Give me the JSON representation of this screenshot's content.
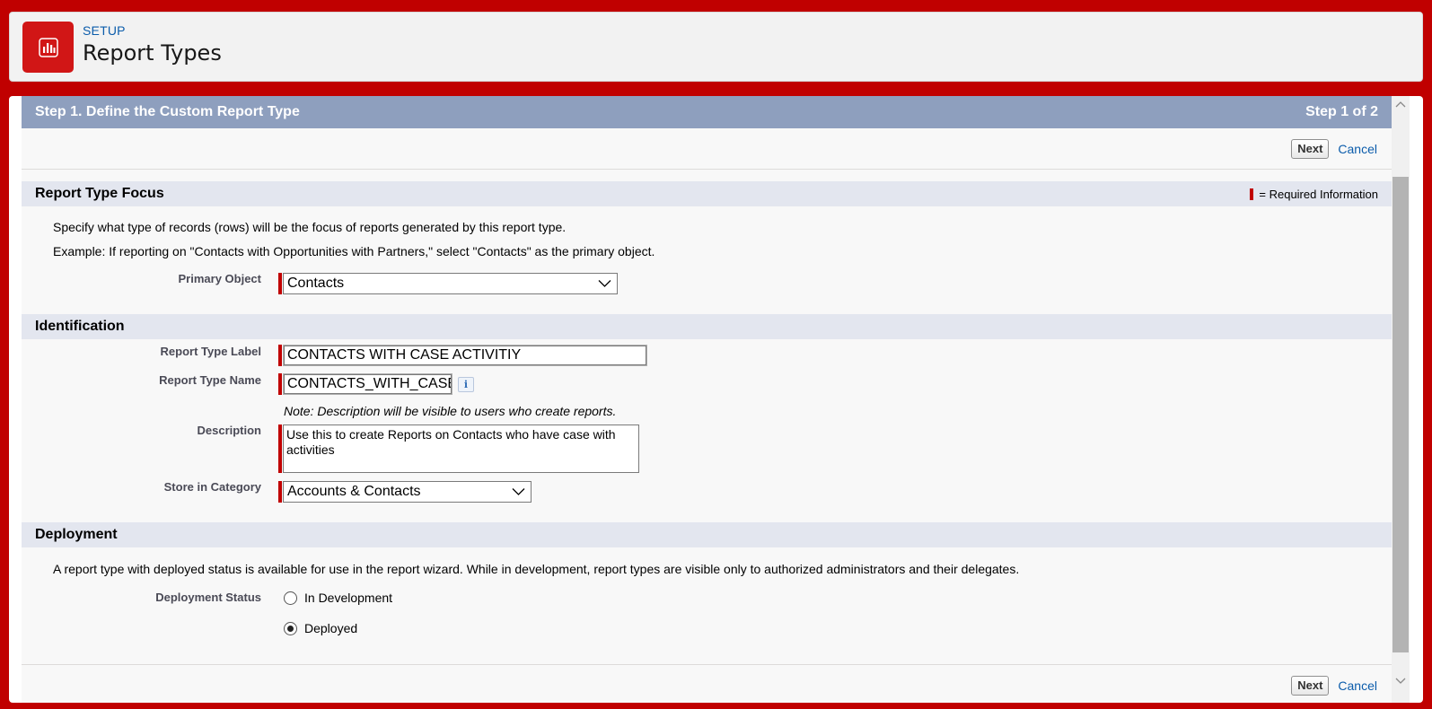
{
  "header": {
    "eyebrow": "SETUP",
    "title": "Report Types",
    "icon": "report-chart-icon"
  },
  "wizard": {
    "title": "Step 1. Define the Custom Report Type",
    "step": "Step 1 of 2",
    "next_label": "Next",
    "cancel_label": "Cancel"
  },
  "focus": {
    "heading": "Report Type Focus",
    "required_legend": "= Required Information",
    "desc1": "Specify what type of records (rows) will be the focus of reports generated by this report type.",
    "desc2": "Example: If reporting on \"Contacts with Opportunities with Partners,\" select \"Contacts\" as the primary object.",
    "primary_object_label": "Primary Object",
    "primary_object_value": "Contacts"
  },
  "identification": {
    "heading": "Identification",
    "label_label": "Report Type Label",
    "label_value": "CONTACTS WITH CASE ACTIVITIY",
    "name_label": "Report Type Name",
    "name_value": "CONTACTS_WITH_CASE_ACTIVITIY",
    "note": "Note: Description will be visible to users who create reports.",
    "description_label": "Description",
    "description_value": "Use this to create Reports on Contacts who have case with activities",
    "category_label": "Store in Category",
    "category_value": "Accounts & Contacts"
  },
  "deployment": {
    "heading": "Deployment",
    "desc": "A report type with deployed status is available for use in the report wizard. While in development, report types are visible only to authorized administrators and their delegates.",
    "status_label": "Deployment Status",
    "options": [
      "In Development",
      "Deployed"
    ],
    "selected": "Deployed"
  },
  "colors": {
    "page_bg": "#c00000",
    "title_bar": "#8e9fbe",
    "section_head": "#e3e6ef",
    "link": "#0b5cab",
    "required": "#c00000"
  }
}
